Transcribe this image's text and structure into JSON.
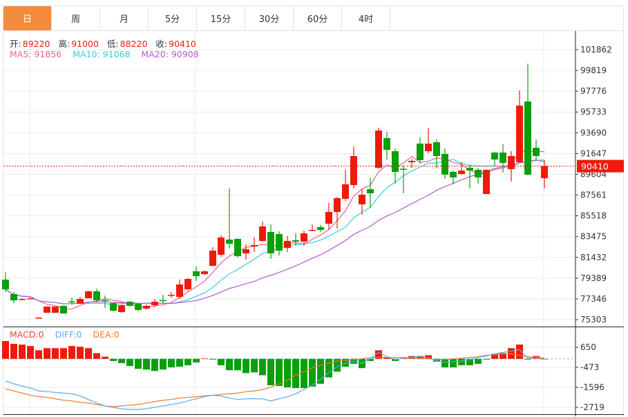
{
  "tabs": [
    {
      "label": "日",
      "active": true
    },
    {
      "label": "周"
    },
    {
      "label": "月"
    },
    {
      "label": "5分"
    },
    {
      "label": "15分"
    },
    {
      "label": "30分"
    },
    {
      "label": "60分"
    },
    {
      "label": "4时"
    }
  ],
  "ohlc_legend": {
    "open_label": "开:",
    "open": "89220",
    "high_label": "高:",
    "high": "91000",
    "low_label": "低:",
    "low": "88220",
    "close_label": "收:",
    "close": "90410"
  },
  "ma_legend": {
    "ma5": "MA5: 91856",
    "ma10": "MA10: 91068",
    "ma20": "MA20: 90908"
  },
  "macd_legend": {
    "macd": "MACD:0",
    "diff": "DIFF:0",
    "dea": "DEA:0"
  },
  "colors": {
    "accent": "#f28b3c",
    "up": "#f01a0a",
    "down": "#0aa00a",
    "ma5": "#f0608a",
    "ma10": "#3cc8dc",
    "ma20": "#b45ad2",
    "diff": "#5aaaf0",
    "dea": "#f07828"
  },
  "chart_data": [
    {
      "type": "candlestick",
      "y_ticks": [
        101862,
        99819,
        97776,
        95733,
        93690,
        91647,
        89604,
        87561,
        85518,
        83475,
        81432,
        79389,
        77346,
        75303
      ],
      "ylim": [
        75303,
        101862
      ],
      "grid": true,
      "last_price": 90410,
      "last_price_label": "90410",
      "candles": [
        [
          79241,
          78290,
          79989,
          78019
        ],
        [
          77815,
          77203,
          78019,
          76932
        ],
        [
          77271,
          77340,
          77400,
          77200
        ],
        [
          77400,
          77407,
          77450,
          77350
        ],
        [
          75480,
          75505,
          75530,
          75480
        ],
        [
          75981,
          76592,
          76592,
          75981
        ],
        [
          75981,
          76592,
          76600,
          75950
        ],
        [
          76660,
          75913,
          76700,
          75900
        ],
        [
          77100,
          77068,
          77475,
          76796
        ],
        [
          76864,
          77339,
          77543,
          76864
        ],
        [
          77407,
          78087,
          78150,
          77407
        ],
        [
          78087,
          77203,
          78358,
          77068
        ],
        [
          77230,
          77203,
          77679,
          76456
        ],
        [
          76932,
          76184,
          76950,
          76100
        ],
        [
          76049,
          76728,
          76800,
          75980
        ],
        [
          77068,
          76660,
          77150,
          76600
        ],
        [
          76864,
          76252,
          76900,
          76150
        ],
        [
          76388,
          76660,
          76800,
          76300
        ],
        [
          76728,
          77068,
          77339,
          76524
        ],
        [
          77230,
          77203,
          77747,
          76864
        ],
        [
          77720,
          77747,
          78019,
          77475
        ],
        [
          77543,
          78766,
          79241,
          77339
        ],
        [
          78290,
          79309,
          79400,
          78150
        ],
        [
          80057,
          79581,
          80532,
          79105
        ],
        [
          79785,
          80057,
          80150,
          79700
        ],
        [
          80600,
          82094,
          82434,
          80550
        ],
        [
          81687,
          83385,
          83600,
          81500
        ],
        [
          83181,
          82774,
          88208,
          82298
        ],
        [
          83249,
          81551,
          83317,
          81415
        ],
        [
          81823,
          82230,
          82706,
          81211
        ],
        [
          82502,
          82638,
          83385,
          81959
        ],
        [
          83045,
          84472,
          84947,
          82950
        ],
        [
          83929,
          81823,
          84676,
          81279
        ],
        [
          83725,
          82094,
          83996,
          81619
        ],
        [
          82366,
          83045,
          83521,
          81959
        ],
        [
          83113,
          82977,
          83793,
          82570
        ],
        [
          82977,
          83793,
          84064,
          82570
        ],
        [
          84064,
          84132,
          84676,
          84000
        ],
        [
          84404,
          84132,
          84608,
          83929
        ],
        [
          84744,
          85898,
          86782,
          84132
        ],
        [
          85898,
          87257,
          87393,
          84268
        ],
        [
          87189,
          88616,
          90042,
          86985
        ],
        [
          88548,
          91401,
          92352,
          88208
        ],
        [
          86646,
          87597,
          88140,
          85627
        ],
        [
          88140,
          87733,
          89227,
          86306
        ],
        [
          90246,
          93914,
          94186,
          90180
        ],
        [
          93167,
          92012,
          93778,
          91061
        ],
        [
          91876,
          89838,
          92148,
          88684
        ],
        [
          90150,
          90110,
          90450,
          87733
        ],
        [
          90789,
          90925,
          91129,
          90246
        ],
        [
          92624,
          90993,
          93235,
          90654
        ],
        [
          91876,
          92624,
          94186,
          91673
        ],
        [
          92759,
          91401,
          93031,
          90178
        ],
        [
          91605,
          89567,
          92148,
          89159
        ],
        [
          89838,
          89295,
          89974,
          88616
        ],
        [
          89635,
          89974,
          90789,
          89567
        ],
        [
          90246,
          89974,
          90518,
          88208
        ],
        [
          90042,
          89295,
          90246,
          88684
        ],
        [
          87665,
          90042,
          90100,
          87665
        ],
        [
          91740,
          91061,
          91800,
          90450
        ],
        [
          91740,
          90722,
          92556,
          89770
        ],
        [
          90110,
          91401,
          91876,
          88887
        ],
        [
          90789,
          96360,
          97854,
          90700
        ],
        [
          96767,
          89567,
          100503,
          89500
        ],
        [
          92216,
          91401,
          93031,
          90925
        ],
        [
          89220,
          90410,
          91000,
          88220
        ]
      ],
      "candle_format": [
        "open",
        "close",
        "high",
        "low"
      ],
      "moving_averages": [
        5,
        10,
        20
      ]
    },
    {
      "type": "bar+line",
      "y_ticks": [
        650,
        -473,
        -1596,
        -2719
      ],
      "grid": true,
      "macd": [
        1000,
        840,
        800,
        720,
        480,
        600,
        600,
        600,
        720,
        680,
        600,
        320,
        120,
        -120,
        -240,
        -400,
        -560,
        -600,
        -680,
        -600,
        -480,
        -440,
        -360,
        -200,
        20,
        -40,
        -360,
        -640,
        -640,
        -800,
        -760,
        -920,
        -1480,
        -1520,
        -1600,
        -1640,
        -1640,
        -1560,
        -1400,
        -1040,
        -720,
        -440,
        -280,
        -520,
        -120,
        480,
        80,
        -120,
        40,
        160,
        160,
        200,
        -160,
        -480,
        -480,
        -360,
        -360,
        -280,
        -40,
        280,
        320,
        600,
        800,
        -40,
        160,
        0
      ],
      "diff": [
        -1240,
        -1400,
        -1520,
        -1640,
        -1800,
        -1840,
        -1880,
        -1920,
        -1960,
        -2080,
        -2280,
        -2480,
        -2640,
        -2720,
        -2800,
        -2840,
        -2840,
        -2800,
        -2720,
        -2640,
        -2560,
        -2480,
        -2360,
        -2240,
        -2120,
        -2040,
        -2080,
        -2200,
        -2280,
        -2240,
        -2240,
        -2240,
        -2360,
        -2240,
        -2120,
        -1960,
        -1720,
        -1480,
        -1160,
        -760,
        -440,
        -240,
        -160,
        -240,
        0,
        360,
        120,
        -40,
        40,
        120,
        120,
        80,
        -120,
        -200,
        -160,
        -120,
        -40,
        80,
        160,
        280,
        360,
        440,
        520,
        40,
        80,
        40
      ],
      "dea": [
        -1680,
        -1800,
        -1920,
        -2040,
        -2120,
        -2160,
        -2240,
        -2320,
        -2360,
        -2440,
        -2480,
        -2560,
        -2640,
        -2680,
        -2640,
        -2600,
        -2560,
        -2480,
        -2400,
        -2320,
        -2280,
        -2200,
        -2160,
        -2120,
        -2080,
        -2040,
        -2000,
        -1960,
        -1920,
        -1840,
        -1800,
        -1720,
        -1600,
        -1400,
        -1200,
        -920,
        -720,
        -520,
        -360,
        -240,
        -120,
        -80,
        -40,
        0,
        80,
        80,
        80,
        80,
        80,
        40,
        40,
        0,
        -40,
        -40,
        0,
        40,
        80,
        120,
        200,
        240,
        280,
        280,
        200,
        120,
        40,
        0
      ]
    }
  ]
}
